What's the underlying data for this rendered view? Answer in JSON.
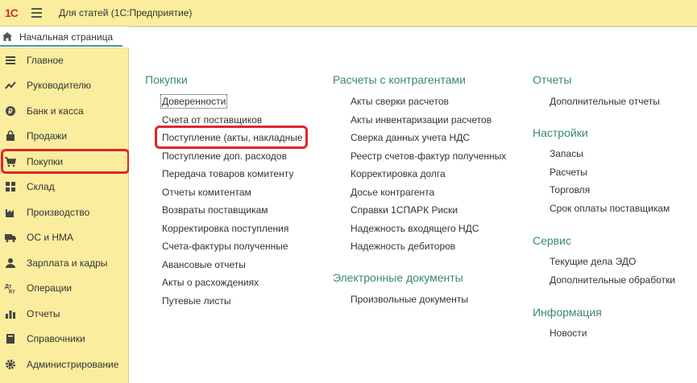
{
  "topbar": {
    "logo": "1С",
    "title": "Для статей  (1С:Предприятие)"
  },
  "hometab": {
    "label": "Начальная страница"
  },
  "sidebar": {
    "items": [
      {
        "label": "Главное",
        "icon": "menu-lines-icon"
      },
      {
        "label": "Руководителю",
        "icon": "trend-icon"
      },
      {
        "label": "Банк и касса",
        "icon": "coin-icon"
      },
      {
        "label": "Продажи",
        "icon": "bag-icon"
      },
      {
        "label": "Покупки",
        "icon": "cart-icon"
      },
      {
        "label": "Склад",
        "icon": "grid-icon"
      },
      {
        "label": "Производство",
        "icon": "factory-icon"
      },
      {
        "label": "ОС и НМА",
        "icon": "truck-icon"
      },
      {
        "label": "Зарплата и кадры",
        "icon": "person-icon"
      },
      {
        "label": "Операции",
        "icon": "dt-kt-icon"
      },
      {
        "label": "Отчеты",
        "icon": "bar-chart-icon"
      },
      {
        "label": "Справочники",
        "icon": "book-icon"
      },
      {
        "label": "Администрирование",
        "icon": "gear-icon"
      }
    ],
    "selected": "Покупки"
  },
  "main": {
    "purchases": {
      "title": "Покупки",
      "links": [
        "Доверенности",
        "Счета от поставщиков",
        "Поступление (акты, накладные",
        "Поступление доп. расходов",
        "Передача товаров комитенту",
        "Отчеты комитентам",
        "Возвраты поставщикам",
        "Корректировка поступления",
        "Счета-фактуры полученные",
        "Авансовые отчеты",
        "Акты о расхождениях",
        "Путевые листы"
      ]
    },
    "counterparties": {
      "title": "Расчеты с контрагентами",
      "links": [
        "Акты сверки расчетов",
        "Акты инвентаризации расчетов",
        "Сверка данных учета НДС",
        "Реестр счетов-фактур полученных",
        "Корректировка долга",
        "Досье контрагента",
        "Справки 1СПАРК Риски",
        "Надежность входящего НДС",
        "Надежность дебиторов"
      ]
    },
    "edocs": {
      "title": "Электронные документы",
      "links": [
        "Произвольные документы"
      ]
    },
    "reports": {
      "title": "Отчеты",
      "links": [
        "Дополнительные отчеты"
      ]
    },
    "settings": {
      "title": "Настройки",
      "links": [
        "Запасы",
        "Расчеты",
        "Торговля",
        "Срок оплаты поставщикам"
      ]
    },
    "service": {
      "title": "Сервис",
      "links": [
        "Текущие дела ЭДО",
        "Дополнительные обработки"
      ]
    },
    "info": {
      "title": "Информация",
      "links": [
        "Новости"
      ]
    }
  },
  "colors": {
    "accent_green": "#3a8a66",
    "panel_yellow": "#fbed9e",
    "highlight_red": "#e0262b"
  }
}
